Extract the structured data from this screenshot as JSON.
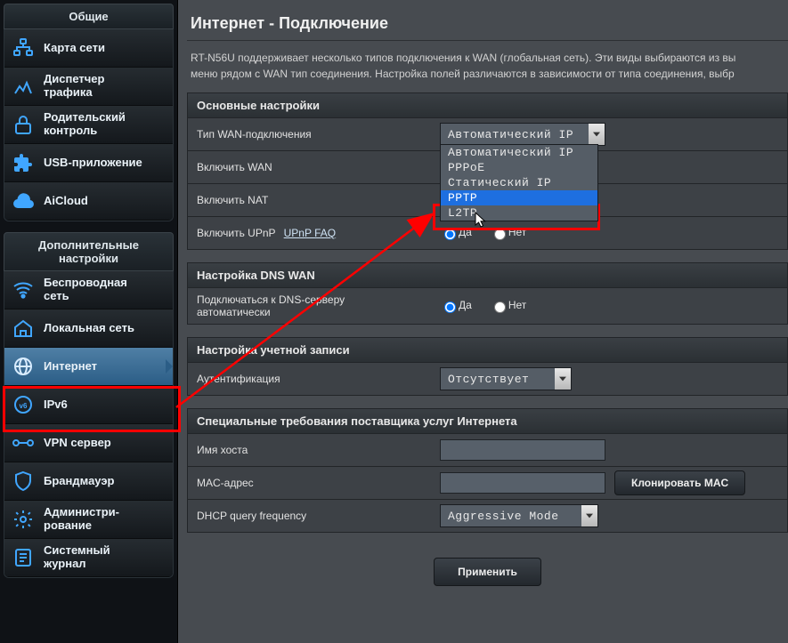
{
  "sidebar": {
    "section_general": "Общие",
    "section_advanced": "Дополнительные настройки",
    "general_items": [
      {
        "label_l1": "Карта сети",
        "label_l2": ""
      },
      {
        "label_l1": "Диспетчер",
        "label_l2": "трафика"
      },
      {
        "label_l1": "Родительский",
        "label_l2": "контроль"
      },
      {
        "label_l1": "USB-приложение",
        "label_l2": ""
      },
      {
        "label_l1": "AiCloud",
        "label_l2": ""
      }
    ],
    "advanced_items": [
      {
        "label_l1": "Беспроводная",
        "label_l2": "сеть"
      },
      {
        "label_l1": "Локальная сеть",
        "label_l2": ""
      },
      {
        "label_l1": "Интернет",
        "label_l2": ""
      },
      {
        "label_l1": "IPv6",
        "label_l2": ""
      },
      {
        "label_l1": "VPN сервер",
        "label_l2": ""
      },
      {
        "label_l1": "Брандмауэр",
        "label_l2": ""
      },
      {
        "label_l1": "Администри-",
        "label_l2": "рование"
      },
      {
        "label_l1": "Системный",
        "label_l2": "журнал"
      }
    ]
  },
  "page": {
    "title": "Интернет - Подключение",
    "intro_l1": "RT-N56U поддерживает несколько типов подключения к WAN (глобальная сеть). Эти виды выбираются из вы",
    "intro_l2": "меню рядом с WAN тип соединения. Настройка полей различаются в зависимости от типа соединения, выбр"
  },
  "radio": {
    "yes": "Да",
    "no": "Нет"
  },
  "basic": {
    "header": "Основные настройки",
    "wan_type_label": "Тип WAN-подключения",
    "wan_type_value": "Автоматический IP",
    "wan_type_options": [
      "Автоматический IP",
      "PPPoE",
      "Статический IP",
      "PPTP",
      "L2TP"
    ],
    "enable_wan_label": "Включить WAN",
    "enable_nat_label": "Включить NAT",
    "enable_upnp_label": "Включить UPnP",
    "upnp_faq": "UPnP  FAQ"
  },
  "dns": {
    "header": "Настройка DNS WAN",
    "auto_l1": "Подключаться к DNS-серверу",
    "auto_l2": "автоматически"
  },
  "account": {
    "header": "Настройка учетной записи",
    "auth_label": "Аутентификация",
    "auth_value": "Отсутствует"
  },
  "isp": {
    "header": "Специальные требования поставщика услуг Интернета",
    "hostname_label": "Имя хоста",
    "hostname_value": "",
    "mac_label": "MAC-адрес",
    "mac_value": "",
    "clone_mac": "Клонировать MAC",
    "dhcp_label": "DHCP query frequency",
    "dhcp_value": "Aggressive Mode"
  },
  "buttons": {
    "apply": "Применить"
  }
}
